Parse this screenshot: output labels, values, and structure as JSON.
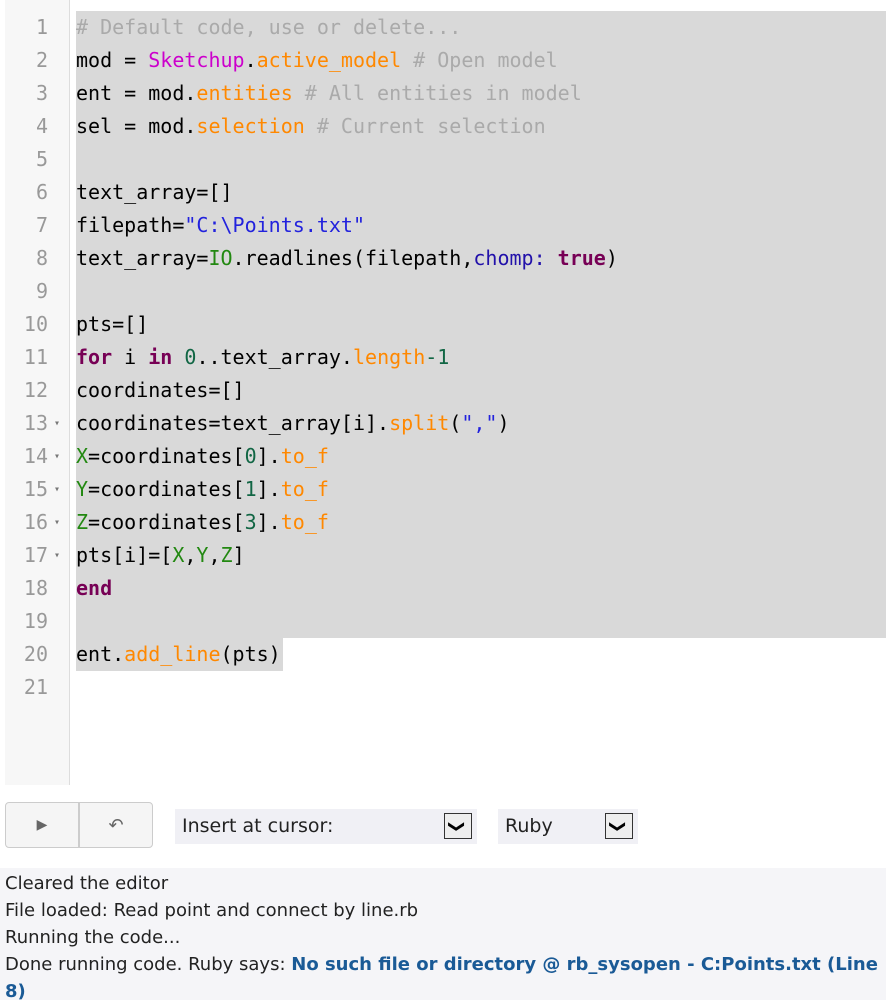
{
  "editor": {
    "lines": [
      {
        "n": "1",
        "tokens": [
          [
            "comment",
            "# Default code, use or delete..."
          ]
        ]
      },
      {
        "n": "2",
        "tokens": [
          [
            "",
            "mod = "
          ],
          [
            "const",
            "Sketchup"
          ],
          [
            "",
            "."
          ],
          [
            "prop",
            "active_model"
          ],
          [
            "comment",
            " # Open model"
          ]
        ]
      },
      {
        "n": "3",
        "tokens": [
          [
            "",
            "ent = mod."
          ],
          [
            "prop",
            "entities"
          ],
          [
            "comment",
            " # All entities in model"
          ]
        ]
      },
      {
        "n": "4",
        "tokens": [
          [
            "",
            "sel = mod."
          ],
          [
            "prop",
            "selection"
          ],
          [
            "comment",
            " # Current selection"
          ]
        ]
      },
      {
        "n": "5",
        "tokens": []
      },
      {
        "n": "6",
        "tokens": [
          [
            "",
            "text_array=[]"
          ]
        ]
      },
      {
        "n": "7",
        "tokens": [
          [
            "",
            "filepath="
          ],
          [
            "str",
            "\"C:\\Points.txt\""
          ]
        ]
      },
      {
        "n": "8",
        "tokens": [
          [
            "",
            "text_array="
          ],
          [
            "cls",
            "IO"
          ],
          [
            "",
            ".readlines(filepath,"
          ],
          [
            "sym",
            "chomp:"
          ],
          [
            "",
            " "
          ],
          [
            "kw",
            "true"
          ],
          [
            "",
            ")"
          ]
        ]
      },
      {
        "n": "9",
        "tokens": []
      },
      {
        "n": "10",
        "tokens": [
          [
            "",
            "pts=[]"
          ]
        ]
      },
      {
        "n": "11",
        "tokens": [
          [
            "kw",
            "for"
          ],
          [
            "",
            " i "
          ],
          [
            "kw",
            "in"
          ],
          [
            "",
            " "
          ],
          [
            "num",
            "0"
          ],
          [
            "",
            "..text_array."
          ],
          [
            "prop",
            "length"
          ],
          [
            "num",
            "-1"
          ]
        ]
      },
      {
        "n": "12",
        "tokens": [
          [
            "",
            "coordinates=[]"
          ]
        ]
      },
      {
        "n": "13",
        "fold": true,
        "tokens": [
          [
            "",
            "coordinates=text_array[i]."
          ],
          [
            "prop",
            "split"
          ],
          [
            "",
            "("
          ],
          [
            "str",
            "\",\""
          ],
          [
            "",
            ")"
          ]
        ]
      },
      {
        "n": "14",
        "fold": true,
        "tokens": [
          [
            "var",
            "X"
          ],
          [
            "",
            "=coordinates["
          ],
          [
            "num",
            "0"
          ],
          [
            "",
            "]."
          ],
          [
            "prop",
            "to_f"
          ]
        ]
      },
      {
        "n": "15",
        "fold": true,
        "tokens": [
          [
            "var",
            "Y"
          ],
          [
            "",
            "=coordinates["
          ],
          [
            "num",
            "1"
          ],
          [
            "",
            "]."
          ],
          [
            "prop",
            "to_f"
          ]
        ]
      },
      {
        "n": "16",
        "fold": true,
        "tokens": [
          [
            "var",
            "Z"
          ],
          [
            "",
            "=coordinates["
          ],
          [
            "num",
            "3"
          ],
          [
            "",
            "]."
          ],
          [
            "prop",
            "to_f"
          ]
        ]
      },
      {
        "n": "17",
        "fold": true,
        "tokens": [
          [
            "",
            "pts[i]=["
          ],
          [
            "var",
            "X"
          ],
          [
            "",
            ","
          ],
          [
            "var",
            "Y"
          ],
          [
            "",
            ","
          ],
          [
            "var",
            "Z"
          ],
          [
            "",
            "]"
          ]
        ]
      },
      {
        "n": "18",
        "tokens": [
          [
            "kw",
            "end"
          ]
        ]
      },
      {
        "n": "19",
        "tokens": []
      },
      {
        "n": "20",
        "tokens": [
          [
            "",
            "ent."
          ],
          [
            "prop",
            "add_line"
          ],
          [
            "",
            "(pts)"
          ]
        ]
      },
      {
        "n": "21",
        "tokens": []
      }
    ],
    "fold_glyph": "▾"
  },
  "toolbar": {
    "run_icon": "▶",
    "undo_icon": "↶",
    "insert_select": "Insert at cursor:",
    "language_select": "Ruby",
    "dropdown_glyph": "❯"
  },
  "output": {
    "lines": [
      "Cleared the editor",
      "File loaded: Read point and connect by line.rb",
      "Running the code..."
    ],
    "last_prefix": "Done running code. Ruby says: ",
    "last_error": "No such file or directory @ rb_sysopen - C:Points.txt (Line 8)"
  }
}
